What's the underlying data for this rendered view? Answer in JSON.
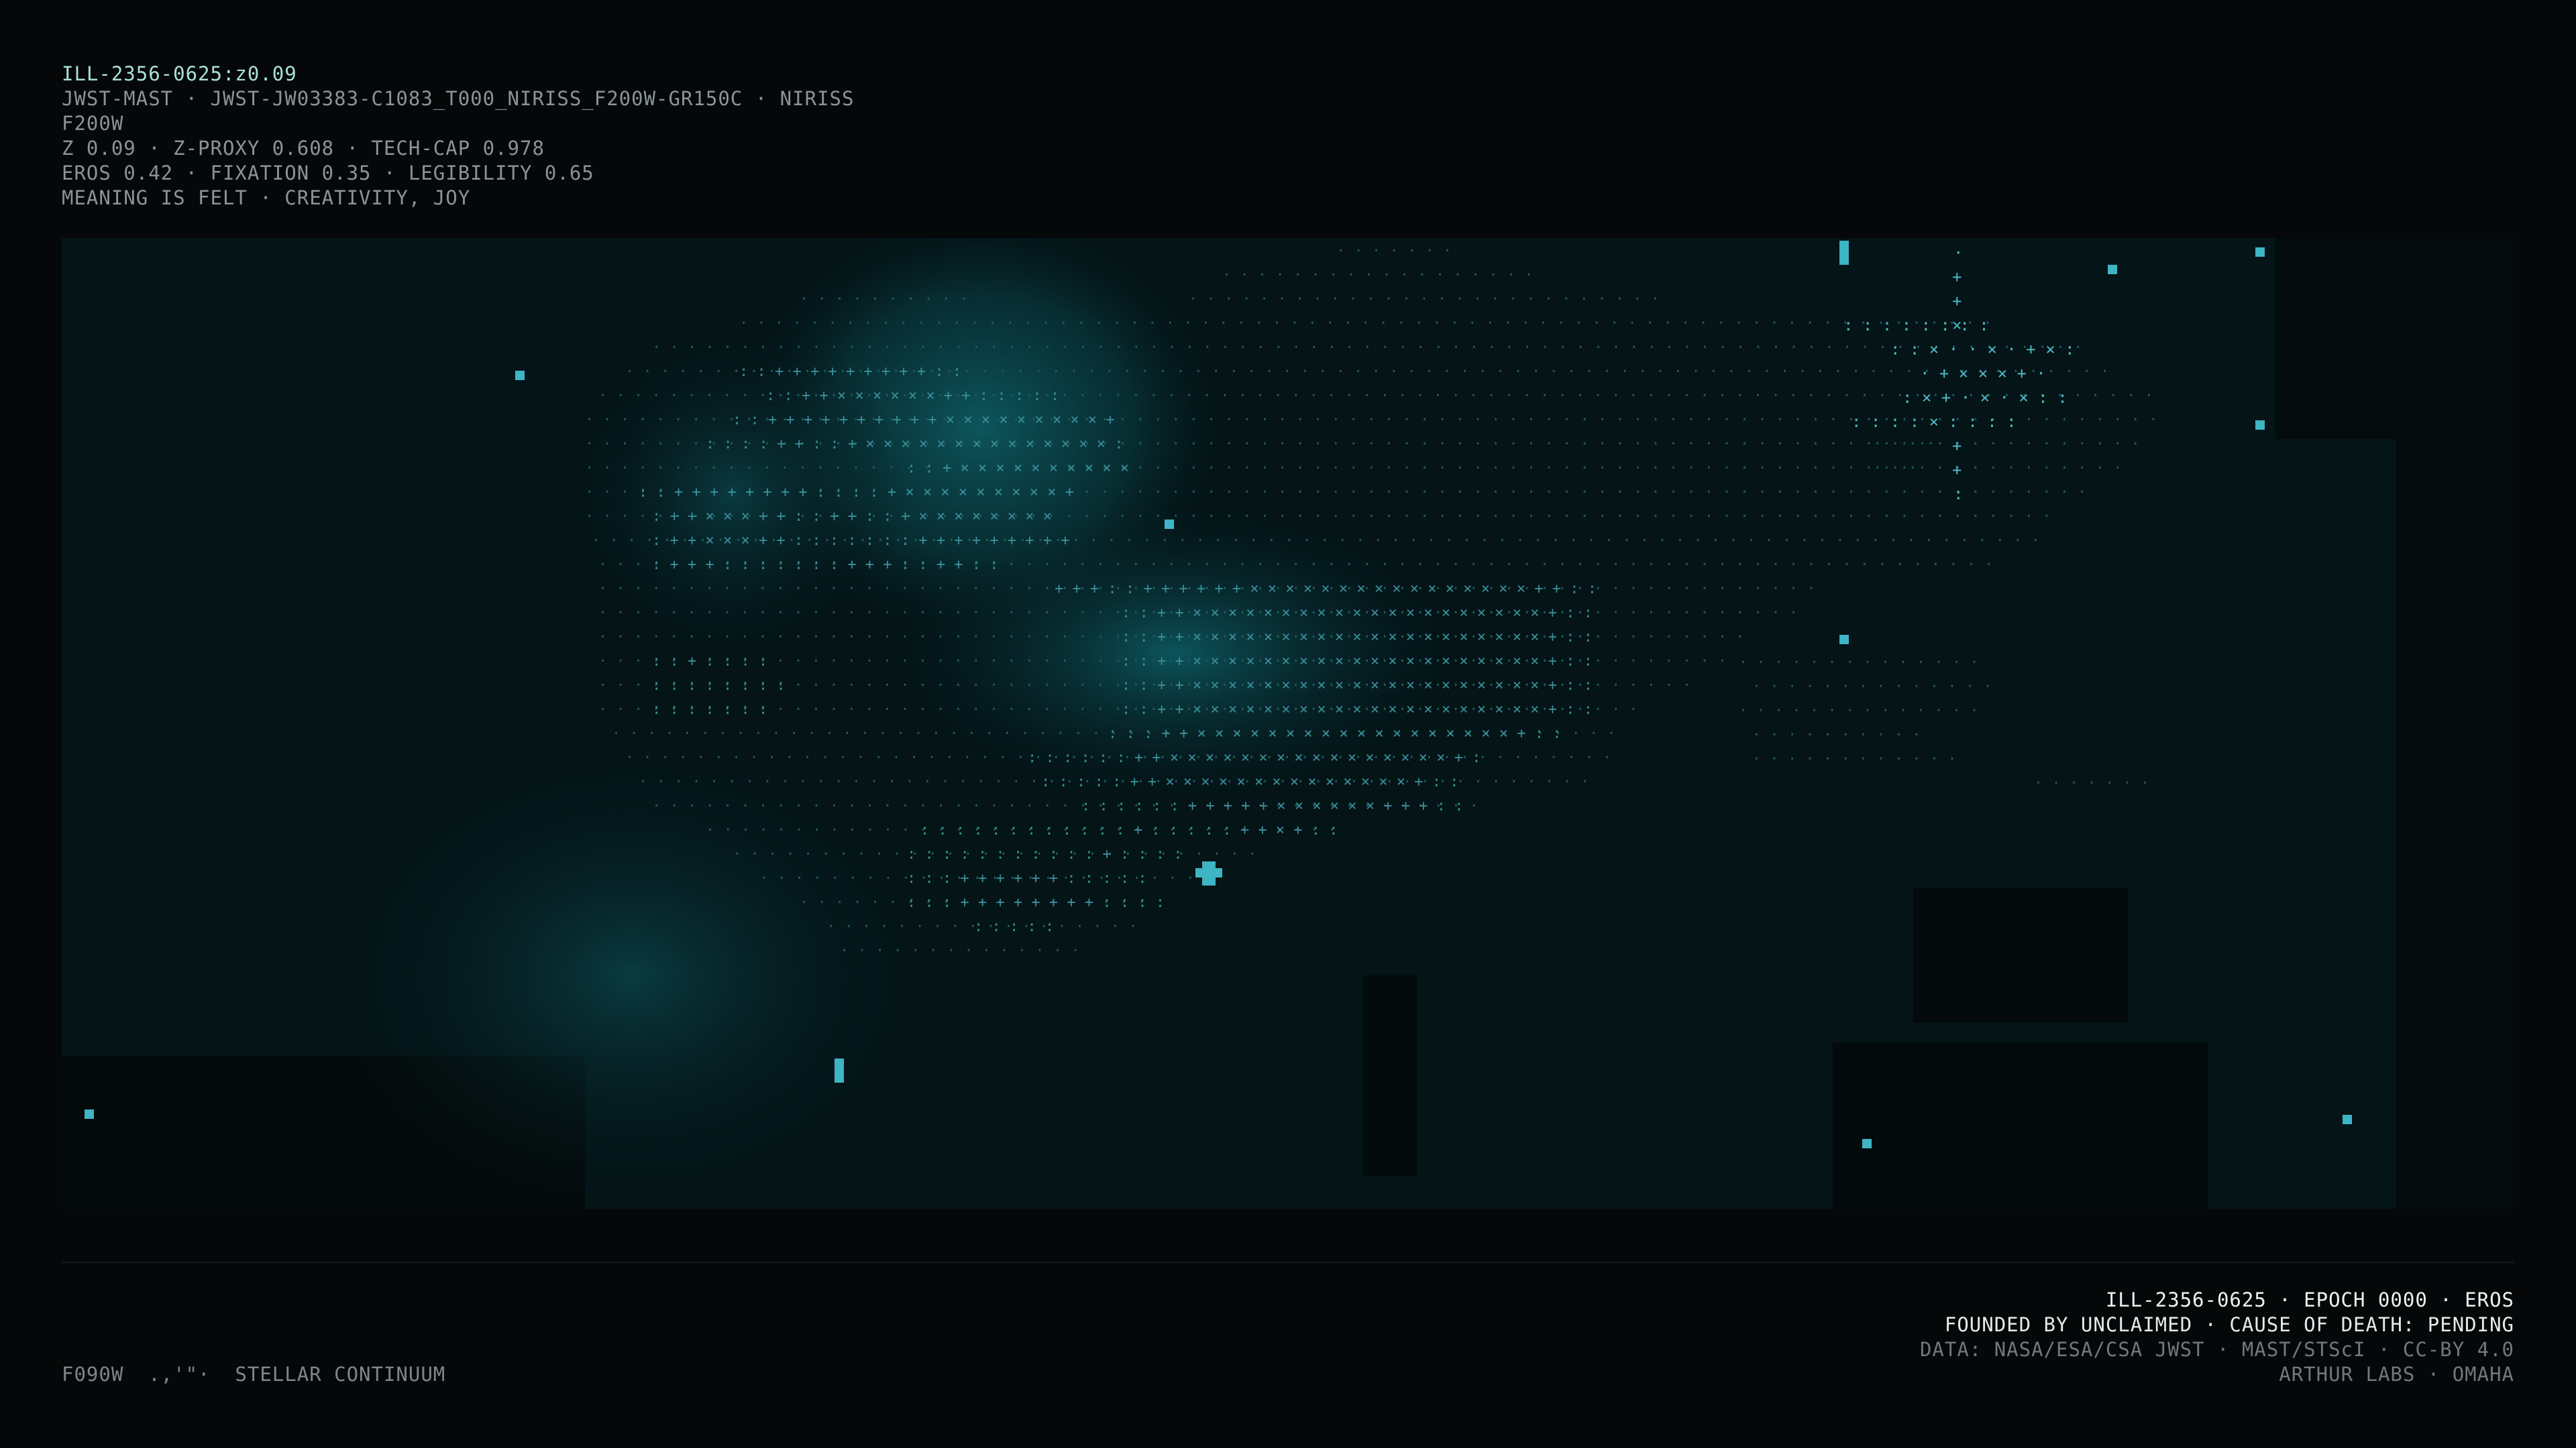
{
  "header": {
    "id_line": "ILL-2356-0625:z0.09",
    "source_line": "JWST-MAST · JWST-JW03383-C1083_T000_NIRISS_F200W-GR150C · NIRISS",
    "filter_line": "F200W",
    "metrics_line": "Z 0.09 · Z-PROXY 0.608 · TECH-CAP 0.978",
    "scores_line": "EROS 0.42 · FIXATION 0.35 · LEGIBILITY 0.65",
    "meaning_line": "MEANING IS FELT · CREATIVITY, JOY"
  },
  "footer": {
    "left_line": "F090W  .,'\"·  STELLAR CONTINUUM",
    "right": {
      "line1": "ILL-2356-0625 · EPOCH 0000 · EROS",
      "line2": "FOUNDED BY UNCLAIMED · CAUSE OF DEATH: PENDING",
      "line3": "DATA: NASA/ESA/CSA JWST · MAST/STScI · CC-BY 4.0",
      "line4": "ARTHUR LABS · OMAHA"
    }
  },
  "colors": {
    "background": "#050708",
    "field": "#041417",
    "glow": "#0c4a50",
    "accent": "#3fb4c4",
    "glyph": "#2f7f8a"
  }
}
